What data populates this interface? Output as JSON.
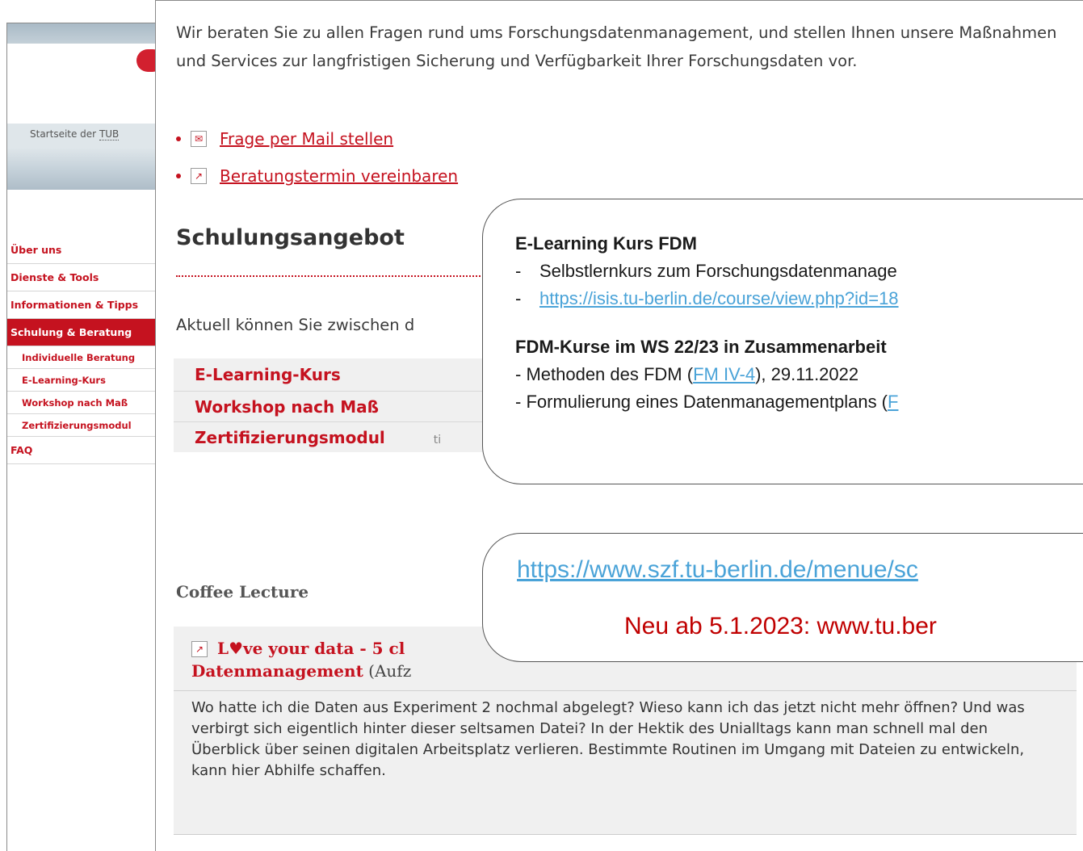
{
  "sidebar": {
    "home_link_prefix": "Startseite der ",
    "home_link_abbr": "TUB",
    "nav_items": [
      {
        "label": "Über uns"
      },
      {
        "label": "Dienste & Tools"
      },
      {
        "label": "Informationen & Tipps"
      },
      {
        "label": "Schulung & Beratung",
        "active": true
      }
    ],
    "sub_items": [
      {
        "label": "Individuelle Beratung"
      },
      {
        "label": "E-Learning-Kurs"
      },
      {
        "label": "Workshop nach Maß"
      },
      {
        "label": "Zertifizierungsmodul"
      }
    ],
    "faq_label": "FAQ"
  },
  "content": {
    "intro": "Wir beraten Sie zu allen Fragen rund ums Forschungsdatenmanagement, und stellen Ihnen unsere Maßnahmen und Services zur langfristigen Sicherung und Verfügbarkeit Ihrer Forschungsdaten vor.",
    "links": [
      {
        "label": "Frage per Mail stellen",
        "icon": "mail-icon",
        "glyph": "✉"
      },
      {
        "label": "Beratungstermin vereinbaren",
        "icon": "external-link-icon",
        "glyph": "↗"
      }
    ],
    "section_title": "Schulungsangebot",
    "aktuell_text": "Aktuell können Sie zwischen d",
    "courses": [
      {
        "label": "E-Learning-Kurs",
        "tail": ""
      },
      {
        "label": "Workshop nach Maß",
        "tail": ""
      },
      {
        "label": "Zertifizierungsmodul",
        "tail": "ti"
      }
    ],
    "coffee_heading": "Coffee Lecture",
    "lecture": {
      "title_line1": "L♥ve your data - 5 cl",
      "title_line2": "Datenmanagement",
      "note": " (Aufz",
      "text": "Wo hatte ich die Daten aus Experiment 2 nochmal abgelegt? Wieso kann ich das jetzt nicht mehr öffnen? Und was verbirgt sich eigentlich hinter dieser seltsamen Datei? In der Hektik des Unialltags kann man schnell mal den Überblick über seinen digitalen Arbeitsplatz verlieren. Bestimmte Routinen im Umgang mit Dateien zu entwickeln, kann hier Abhilfe schaffen."
    }
  },
  "callout1": {
    "heading": "E-Learning Kurs FDM",
    "line1_dash": "-",
    "line1_text": "Selbstlernkurs zum Forschungsdatenmanage",
    "line2_dash": "-",
    "line2_link": "https://isis.tu-berlin.de/course/view.php?id=18",
    "heading2": "FDM-Kurse im WS 22/23 in Zusammenarbeit",
    "line3_pre": "- Methoden des FDM (",
    "line3_link": "FM IV-4",
    "line3_post": "), 29.11.2022",
    "line4_pre": "- Formulierung eines Datenmanagementplans (",
    "line4_link": "F"
  },
  "callout2": {
    "link": "https://www.szf.tu-berlin.de/menue/sc",
    "news": "Neu ab 5.1.2023:   www.tu.ber"
  },
  "colors": {
    "tu_red": "#c5121f",
    "callout_link_blue": "#4aa3d8",
    "callout_news_red": "#c00000"
  }
}
